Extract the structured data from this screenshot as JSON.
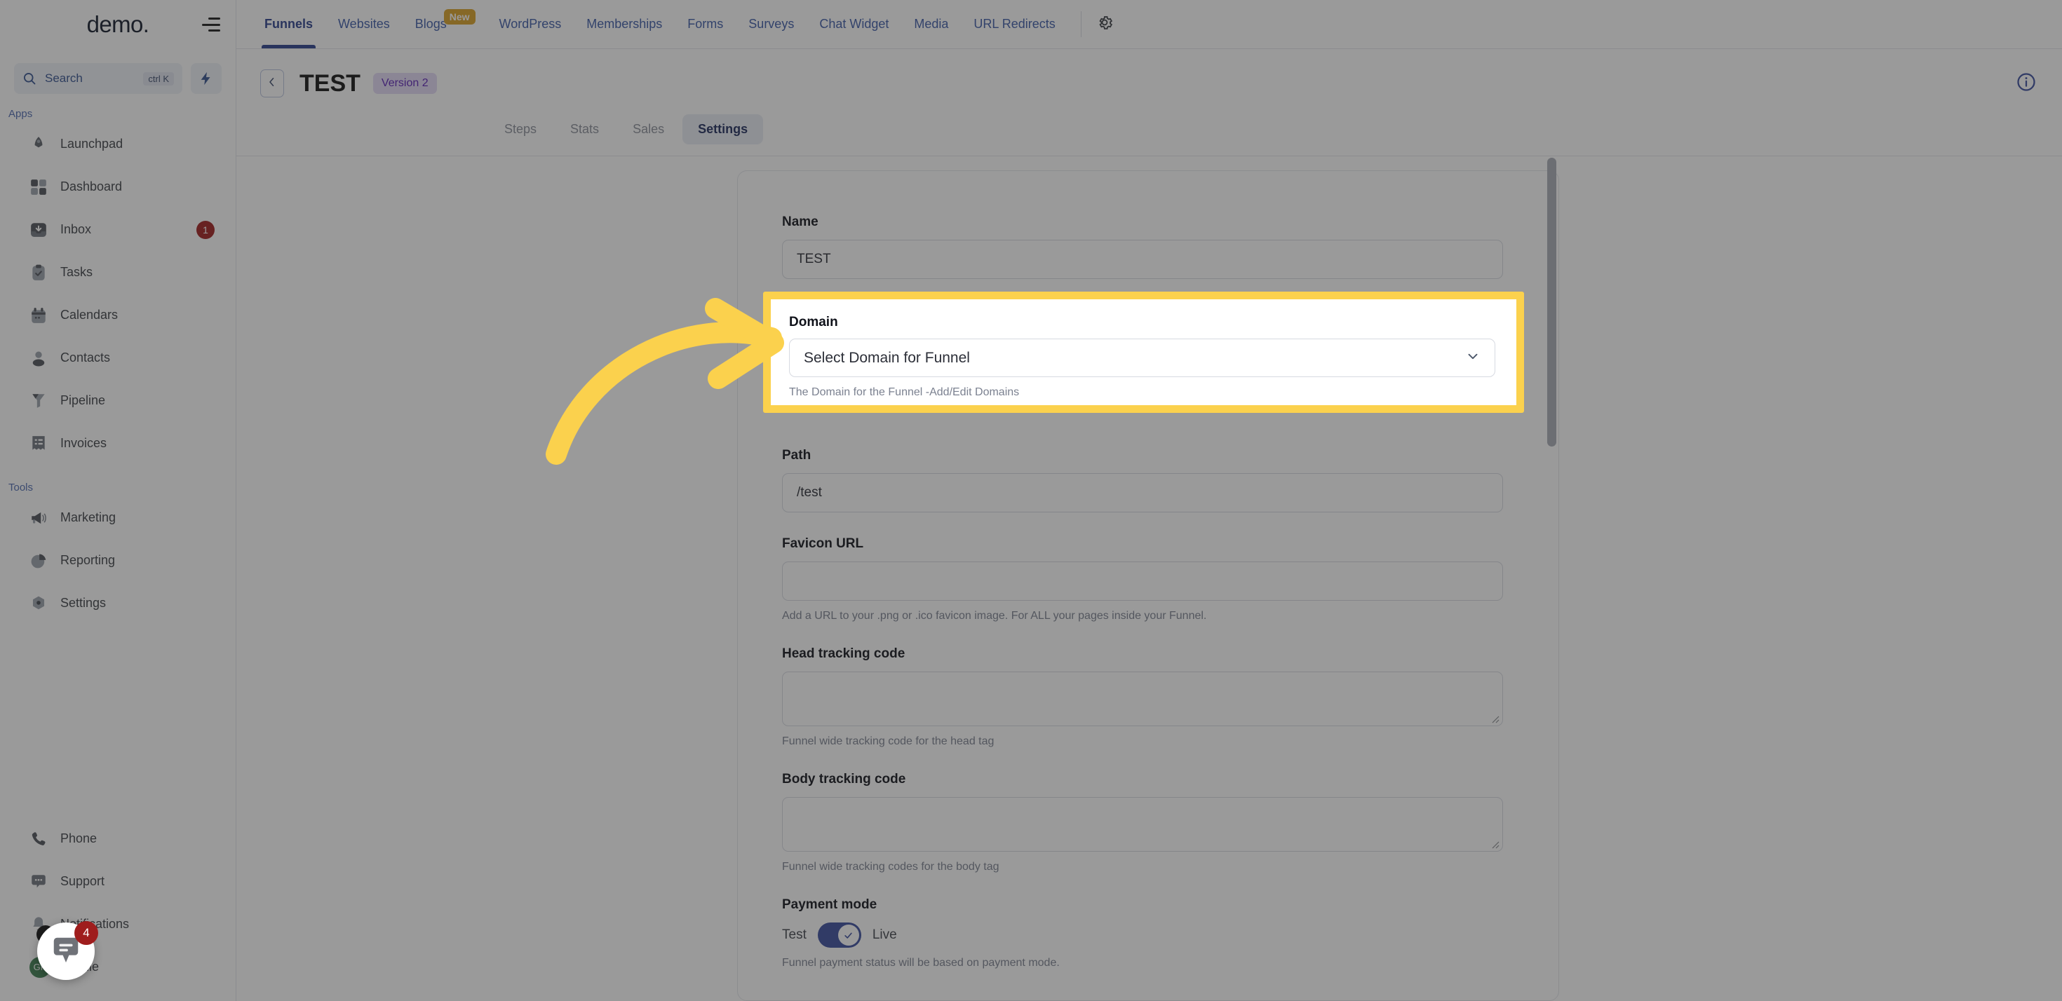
{
  "sidebar": {
    "brand": "demo",
    "brand_dot": ".",
    "search": {
      "label": "Search",
      "shortcut": "ctrl K",
      "placeholder": "Search"
    },
    "groups": [
      {
        "label": "Apps",
        "items": [
          {
            "label": "Launchpad",
            "icon": "rocket-icon",
            "badge": ""
          },
          {
            "label": "Dashboard",
            "icon": "grid-icon",
            "badge": ""
          },
          {
            "label": "Inbox",
            "icon": "inbox-icon",
            "badge": "1"
          },
          {
            "label": "Tasks",
            "icon": "clipboard-check-icon",
            "badge": ""
          },
          {
            "label": "Calendars",
            "icon": "calendar-icon",
            "badge": ""
          },
          {
            "label": "Contacts",
            "icon": "person-icon",
            "badge": ""
          },
          {
            "label": "Pipeline",
            "icon": "funnel-icon",
            "badge": ""
          },
          {
            "label": "Invoices",
            "icon": "invoice-icon",
            "badge": ""
          }
        ]
      },
      {
        "label": "Tools",
        "items": [
          {
            "label": "Marketing",
            "icon": "megaphone-icon",
            "badge": ""
          },
          {
            "label": "Reporting",
            "icon": "pie-chart-icon",
            "badge": ""
          },
          {
            "label": "Settings",
            "icon": "gear-dot-icon",
            "badge": ""
          }
        ]
      }
    ],
    "bottom_items": [
      {
        "label": "Phone",
        "icon": "phone-icon",
        "badge": ""
      },
      {
        "label": "Support",
        "icon": "chat-dots-icon",
        "badge": ""
      },
      {
        "label": "Notifications",
        "icon": "bell-icon",
        "badge": "4"
      },
      {
        "label": "Profile",
        "icon": "avatar-icon",
        "badge": "",
        "avatar_initials": "GP"
      }
    ]
  },
  "topnav": {
    "items": [
      {
        "label": "Funnels",
        "active": true,
        "badge": ""
      },
      {
        "label": "Websites",
        "active": false,
        "badge": ""
      },
      {
        "label": "Blogs",
        "active": false,
        "badge": "New"
      },
      {
        "label": "WordPress",
        "active": false,
        "badge": ""
      },
      {
        "label": "Memberships",
        "active": false,
        "badge": ""
      },
      {
        "label": "Forms",
        "active": false,
        "badge": ""
      },
      {
        "label": "Surveys",
        "active": false,
        "badge": ""
      },
      {
        "label": "Chat Widget",
        "active": false,
        "badge": ""
      },
      {
        "label": "Media",
        "active": false,
        "badge": ""
      },
      {
        "label": "URL Redirects",
        "active": false,
        "badge": ""
      }
    ],
    "gear_icon": "gear-icon"
  },
  "header": {
    "back_icon": "chevron-left-icon",
    "title": "TEST",
    "version_badge": "Version 2",
    "info_icon": "info-circle-icon"
  },
  "subtabs": [
    {
      "label": "Steps",
      "active": false
    },
    {
      "label": "Stats",
      "active": false
    },
    {
      "label": "Sales",
      "active": false
    },
    {
      "label": "Settings",
      "active": true
    }
  ],
  "form": {
    "name": {
      "label": "Name",
      "value": "TEST",
      "placeholder": ""
    },
    "domain": {
      "label": "Domain",
      "value": "Select Domain for Funnel",
      "helper": "The Domain for the Funnel -Add/Edit Domains",
      "chevron_icon": "chevron-down-icon",
      "highlighted": true
    },
    "path": {
      "label": "Path",
      "value": "/test",
      "placeholder": ""
    },
    "favicon": {
      "label": "Favicon URL",
      "value": "",
      "placeholder": "",
      "helper": "Add a URL to your .png or .ico favicon image. For ALL your pages inside your Funnel."
    },
    "head_tracking": {
      "label": "Head tracking code",
      "value": "",
      "helper": "Funnel wide tracking code for the head tag"
    },
    "body_tracking": {
      "label": "Body tracking code",
      "value": "",
      "helper": "Funnel wide tracking codes for the body tag"
    },
    "payment_mode": {
      "label": "Payment mode",
      "off_label": "Test",
      "on_label": "Live",
      "state": "Live",
      "helper": "Funnel payment status will be based on payment mode."
    }
  },
  "annotation": {
    "arrow_color": "#fbd14d",
    "highlight_color": "#fbd14d",
    "target": "domain-select"
  },
  "chat_widget": {
    "icon": "chat-bubble-icon",
    "badge": "4"
  }
}
